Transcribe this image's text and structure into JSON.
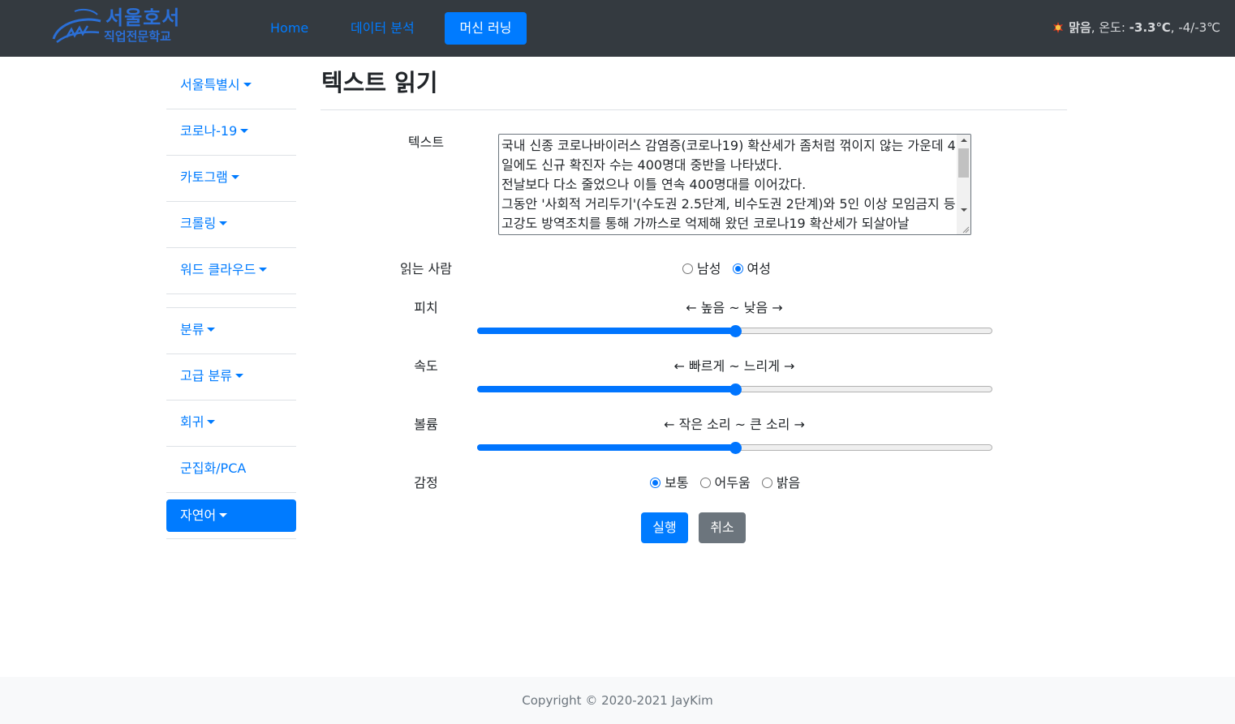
{
  "brand": {
    "line1": "서울호서",
    "line2": "직업전문학교"
  },
  "nav": {
    "home": "Home",
    "data_analysis": "데이터 분석",
    "machine_learning": "머신 러닝"
  },
  "weather": {
    "condition": "맑음",
    "temp_label": "온도:",
    "temp": "-3.3℃",
    "range": "-4/-3℃"
  },
  "sidebar": {
    "items": [
      {
        "label": "서울특별시",
        "dropdown": true
      },
      {
        "label": "코로나-19",
        "dropdown": true
      },
      {
        "label": "카토그램",
        "dropdown": true
      },
      {
        "label": "크롤링",
        "dropdown": true
      },
      {
        "label": "워드 클라우드",
        "dropdown": true
      }
    ],
    "items2": [
      {
        "label": "분류",
        "dropdown": true
      },
      {
        "label": "고급 분류",
        "dropdown": true
      },
      {
        "label": "회귀",
        "dropdown": true
      },
      {
        "label": "군집화/PCA",
        "dropdown": false
      }
    ],
    "active": {
      "label": "자연어",
      "dropdown": true
    }
  },
  "page": {
    "title": "텍스트 읽기"
  },
  "form": {
    "text_label": "텍스트",
    "text_value": "국내 신종 코로나바이러스 감염증(코로나19) 확산세가 좀처럼 꺾이지 않는 가운데 4일에도 신규 확진자 수는 400명대 중반을 나타냈다.\n전날보다 다소 줄었으나 이틀 연속 400명대를 이어갔다.\n그동안 '사회적 거리두기'(수도권 2.5단계, 비수도권 2단계)와 5인 이상 모임금지 등 고강도 방역조치를 통해 가까스로 억제해 왔던 코로나19 확산세가 되살아날",
    "reader_label": "읽는 사람",
    "reader_options": [
      "남성",
      "여성"
    ],
    "reader_selected": 1,
    "pitch_label": "피치",
    "pitch_hint": "← 높음 ~ 낮음 →",
    "pitch_value": 0.5,
    "speed_label": "속도",
    "speed_hint": "← 빠르게 ~ 느리게 →",
    "speed_value": 0.5,
    "volume_label": "볼륨",
    "volume_hint": "← 작은 소리 ~ 큰 소리 →",
    "volume_value": 0.5,
    "emotion_label": "감정",
    "emotion_options": [
      "보통",
      "어두움",
      "밝음"
    ],
    "emotion_selected": 0,
    "run_button": "실행",
    "cancel_button": "취소"
  },
  "footer": {
    "copyright": "Copyright © 2020-2021 JayKim"
  },
  "colors": {
    "navbar": "#343a40",
    "primary": "#007bff",
    "secondary": "#6c757d",
    "range_accent": "#0075ff"
  }
}
